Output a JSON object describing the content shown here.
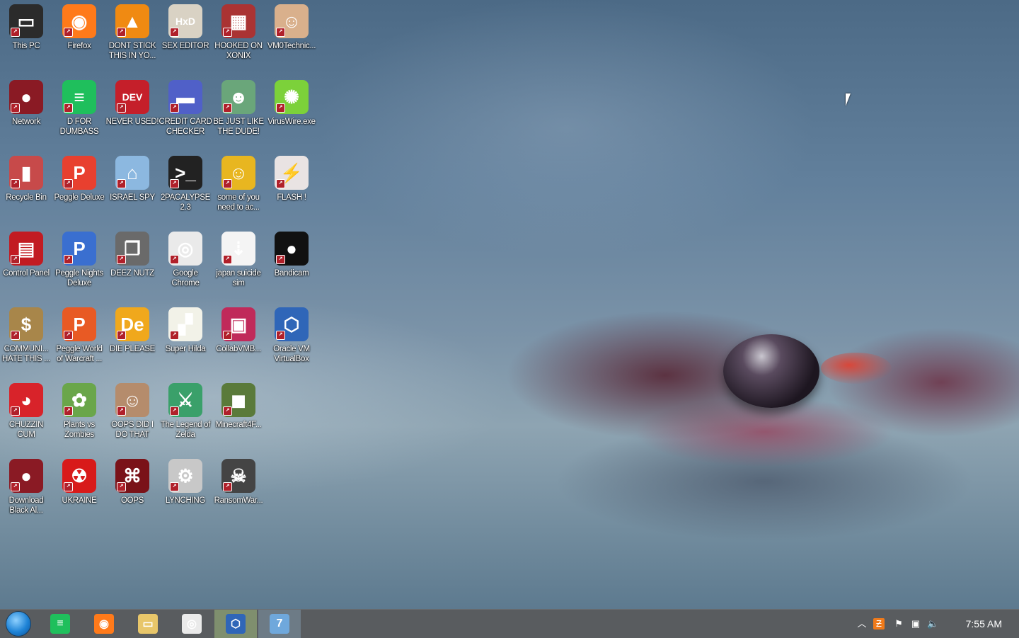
{
  "desktop": {
    "icons": [
      {
        "label": "This PC",
        "icon": "this-pc-icon",
        "bg": "#2b2b2b",
        "glyph": "▭"
      },
      {
        "label": "Firefox",
        "icon": "firefox-icon",
        "bg": "#ff7a1a",
        "glyph": "◉"
      },
      {
        "label": "DONT STICK THIS IN YO...",
        "icon": "vlc-cone-icon",
        "bg": "#f08a12",
        "glyph": "▲"
      },
      {
        "label": "SEX EDITOR",
        "icon": "hxd-editor-icon",
        "bg": "#d9d2c4",
        "glyph": "HxD"
      },
      {
        "label": "HOOKED ON XONIX",
        "icon": "xonix-game-icon",
        "bg": "#a33",
        "glyph": "▦"
      },
      {
        "label": "VM0Technic...",
        "icon": "doctor-icon",
        "bg": "#d9b08c",
        "glyph": "☺"
      },
      {
        "label": "Network",
        "icon": "network-orb-icon",
        "bg": "#8a1a24",
        "glyph": "●"
      },
      {
        "label": "D FOR DUMBASS",
        "icon": "chat-d-icon",
        "bg": "#1fbf5c",
        "glyph": "≡"
      },
      {
        "label": "NEVER USED!",
        "icon": "dev-cpp-icon",
        "bg": "#c51f2a",
        "glyph": "DEV"
      },
      {
        "label": "CREDIT CARD CHECKER",
        "icon": "credit-card-icon",
        "bg": "#5060c8",
        "glyph": "▬"
      },
      {
        "label": "BE JUST LIKE THE DUDE!",
        "icon": "santa-dude-icon",
        "bg": "#6aa67a",
        "glyph": "☻"
      },
      {
        "label": "VirusWire.exe",
        "icon": "lime-icon",
        "bg": "#7cd13a",
        "glyph": "✺"
      },
      {
        "label": "Recycle Bin",
        "icon": "recycle-bin-icon",
        "bg": "#c74a4a",
        "glyph": "▮"
      },
      {
        "label": "Peggle Deluxe",
        "icon": "peggle-icon",
        "bg": "#e8402f",
        "glyph": "P"
      },
      {
        "label": "ISRAEL SPY",
        "icon": "spy-network-icon",
        "bg": "#8cb8e0",
        "glyph": "⌂"
      },
      {
        "label": "2PACALYPSE 2.3",
        "icon": "terminal-icon",
        "bg": "#222",
        "glyph": ">_"
      },
      {
        "label": "some of you need to ac...",
        "icon": "beaver-icon",
        "bg": "#e8b620",
        "glyph": "☺"
      },
      {
        "label": "FLASH !",
        "icon": "flash-card-icon",
        "bg": "#e9e3e3",
        "glyph": "⚡"
      },
      {
        "label": "Control Panel",
        "icon": "control-panel-icon",
        "bg": "#c21b22",
        "glyph": "▤"
      },
      {
        "label": "Peggle Nights Deluxe",
        "icon": "peggle-nights-icon",
        "bg": "#3a6fd0",
        "glyph": "P"
      },
      {
        "label": "DEEZ NUTZ",
        "icon": "stacked-windows-icon",
        "bg": "#6a6a6a",
        "glyph": "❐"
      },
      {
        "label": "Google Chrome",
        "icon": "chrome-icon",
        "bg": "#eaeaea",
        "glyph": "◎"
      },
      {
        "label": "japan suicide sim",
        "icon": "japan-sim-icon",
        "bg": "#f4f4f4",
        "glyph": "⇣"
      },
      {
        "label": "Bandicam",
        "icon": "bandicam-icon",
        "bg": "#111",
        "glyph": "●"
      },
      {
        "label": "COMMUNI... HATE THIS ...",
        "icon": "money-bag-icon",
        "bg": "#a8864a",
        "glyph": "$"
      },
      {
        "label": "Peggle World of Warcraft ...",
        "icon": "peggle-wow-icon",
        "bg": "#e85a24",
        "glyph": "P"
      },
      {
        "label": "DIE PLEASE",
        "icon": "de-app-icon",
        "bg": "#f0a81c",
        "glyph": "De"
      },
      {
        "label": "Super Hilda",
        "icon": "pixel-dog-icon",
        "bg": "#f2f2e8",
        "glyph": "▞"
      },
      {
        "label": "CollabVMB...",
        "icon": "monitor-icon",
        "bg": "#c02a5a",
        "glyph": "▣"
      },
      {
        "label": "Oracle VM VirtualBox",
        "icon": "virtualbox-icon",
        "bg": "#2f66b8",
        "glyph": "⬡"
      },
      {
        "label": "CHUZZIN CUM",
        "icon": "chuzzle-icon",
        "bg": "#d8232a",
        "glyph": "◕"
      },
      {
        "label": "Plants vs Zombies",
        "icon": "plants-zombies-icon",
        "bg": "#6aa64a",
        "glyph": "✿"
      },
      {
        "label": "OOPS DID I DO THAT",
        "icon": "portrait-icon",
        "bg": "#b58c6c",
        "glyph": "☺"
      },
      {
        "label": "The Legend of Zelda",
        "icon": "zelda-link-icon",
        "bg": "#3aa06a",
        "glyph": "⚔"
      },
      {
        "label": "Minecraft4F...",
        "icon": "minecraft-block-icon",
        "bg": "#5a7a3a",
        "glyph": "◼"
      },
      {
        "label": "",
        "icon": "",
        "bg": "",
        "glyph": ""
      },
      {
        "label": "Download Black Al...",
        "icon": "dark-orb-icon",
        "bg": "#8a1a24",
        "glyph": "●"
      },
      {
        "label": "UKRAINE",
        "icon": "radiation-icon",
        "bg": "#d81a1a",
        "glyph": "☢"
      },
      {
        "label": "OOPS",
        "icon": "red-app-icon",
        "bg": "#7a1218",
        "glyph": "⌘"
      },
      {
        "label": "LYNCHING",
        "icon": "gear-flag-icon",
        "bg": "#c8c8c8",
        "glyph": "⚙"
      },
      {
        "label": "RansomWar...",
        "icon": "skull-icon",
        "bg": "#444",
        "glyph": "☠"
      }
    ]
  },
  "taskbar": {
    "apps": [
      {
        "name": "chat-app",
        "icon": "chat-icon",
        "color": "#1fbf5c",
        "glyph": "≡"
      },
      {
        "name": "firefox",
        "icon": "firefox-icon",
        "color": "#ff7a1a",
        "glyph": "◉"
      },
      {
        "name": "file-explorer",
        "icon": "folder-icon",
        "color": "#e8c66a",
        "glyph": "▭"
      },
      {
        "name": "chrome",
        "icon": "chrome-icon",
        "color": "#eaeaea",
        "glyph": "◎"
      },
      {
        "name": "virtualbox",
        "icon": "virtualbox-icon",
        "color": "#2f66b8",
        "glyph": "⬡"
      },
      {
        "name": "win7-app",
        "icon": "win7-flag-icon",
        "color": "#6fa8dc",
        "glyph": "7"
      }
    ],
    "clock": "7:55 AM"
  }
}
